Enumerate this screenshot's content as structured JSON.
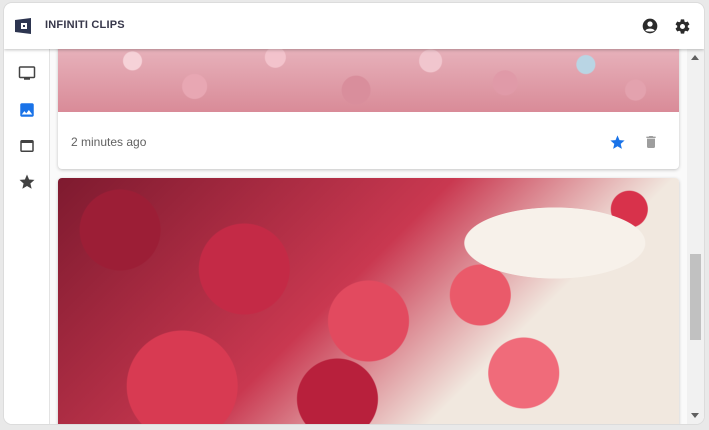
{
  "app": {
    "title": "INFINITI CLIPS"
  },
  "header": {
    "icons": [
      "account-circle-icon",
      "settings-gear-icon"
    ]
  },
  "sidebar": {
    "items": [
      {
        "icon": "monitor-icon",
        "active": false
      },
      {
        "icon": "image-icon",
        "active": true
      },
      {
        "icon": "window-icon",
        "active": false
      },
      {
        "icon": "star-icon",
        "active": false
      }
    ]
  },
  "clips": [
    {
      "type": "image",
      "image": "cherry-blossom-photo",
      "time": "2 minutes ago",
      "favorite": true,
      "actions": [
        "star-icon",
        "delete-icon"
      ]
    },
    {
      "type": "image",
      "image": "red-maple-leaves-photo"
    }
  ],
  "colors": {
    "accent": "#1a73e8",
    "nav_icon": "#424242",
    "action_muted": "#9e9e9e",
    "title_text": "#37374a"
  }
}
